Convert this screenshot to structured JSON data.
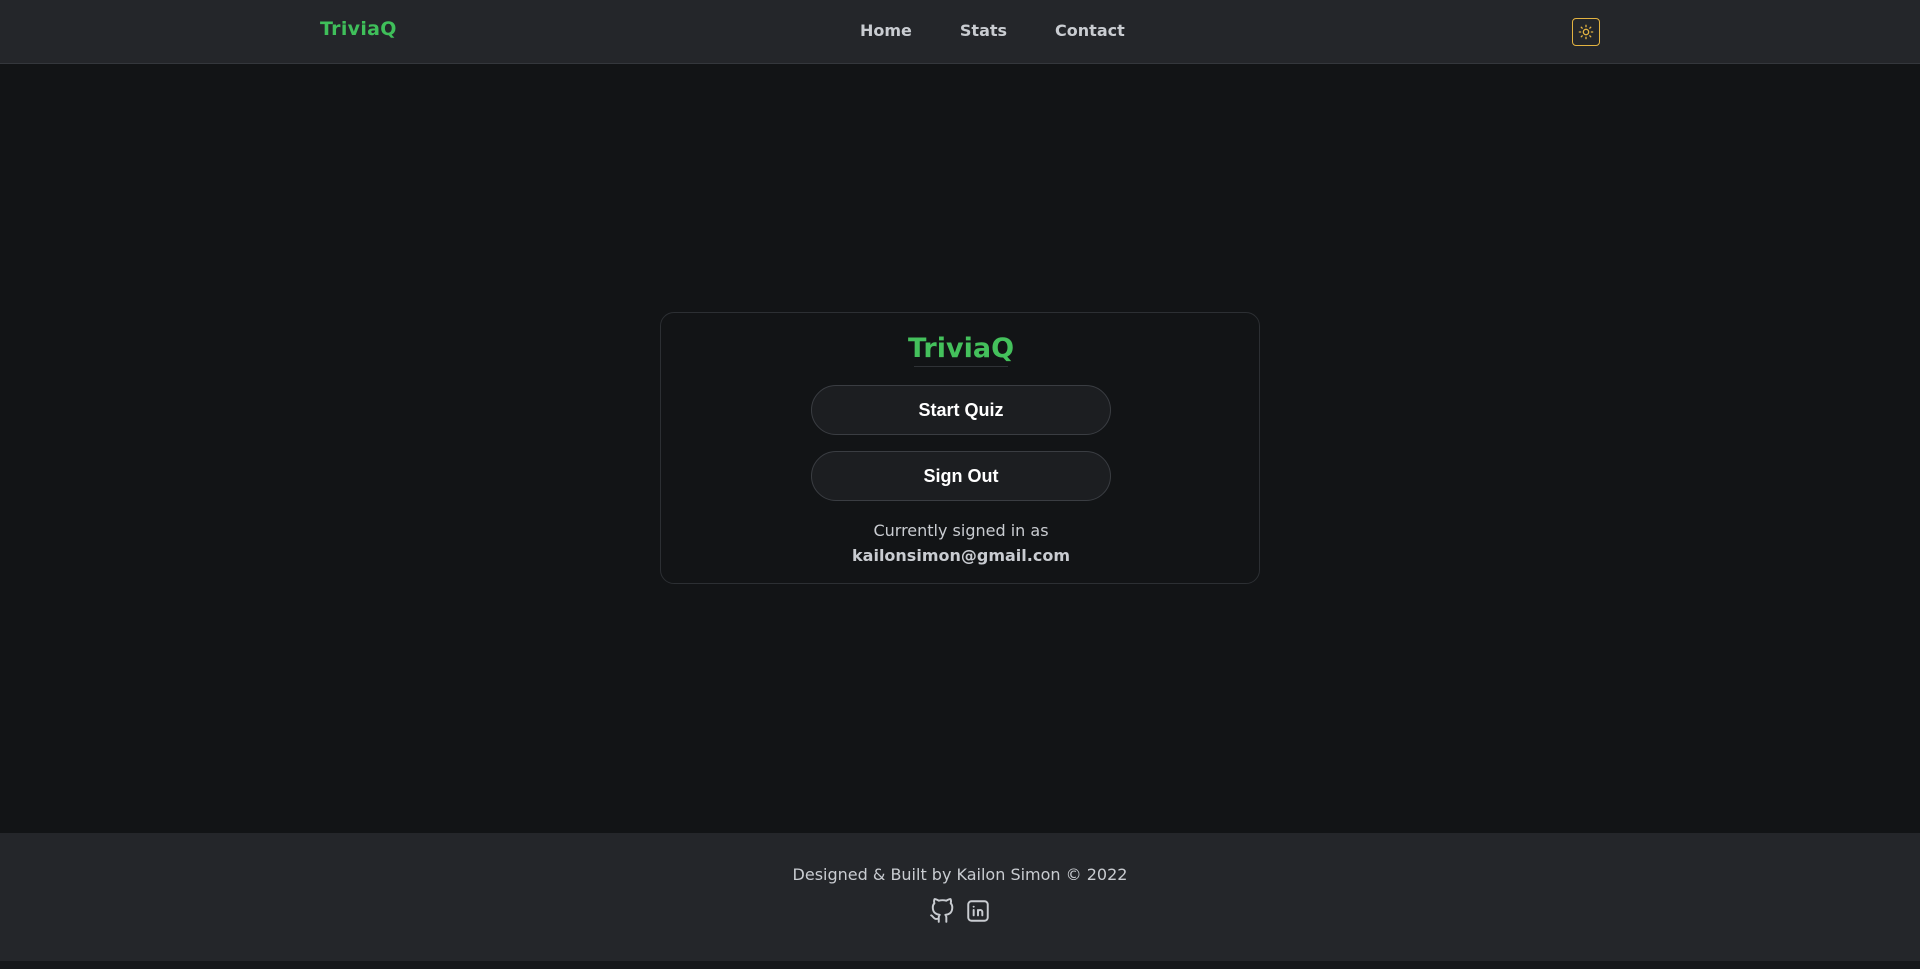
{
  "header": {
    "brand": "TriviaQ",
    "nav": [
      {
        "label": "Home"
      },
      {
        "label": "Stats"
      },
      {
        "label": "Contact"
      }
    ],
    "theme_toggle_icon": "sun-icon",
    "accent_color": "#e3b341"
  },
  "card": {
    "title": "TriviaQ",
    "start_label": "Start Quiz",
    "signout_label": "Sign Out",
    "signed_in_label": "Currently signed in as",
    "email": "kailonsimon@gmail.com"
  },
  "footer": {
    "credit": "Designed & Built by Kailon Simon © 2022",
    "social": [
      {
        "icon": "github-icon"
      },
      {
        "icon": "linkedin-icon"
      }
    ]
  },
  "colors": {
    "brand_green": "#3fbf5a",
    "background": "#121416",
    "header_bg": "#24262a"
  }
}
